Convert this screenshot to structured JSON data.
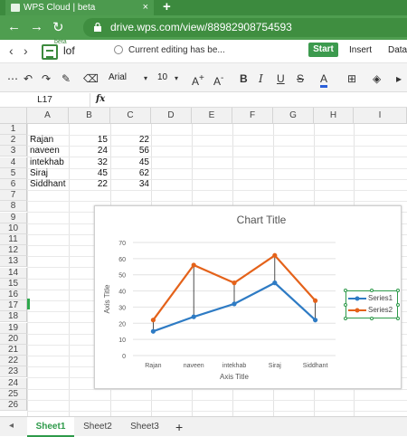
{
  "browser": {
    "tab_title": "WPS Cloud | beta",
    "tab_close": "×",
    "new_tab": "+",
    "url": "drive.wps.com/view/88982908754593"
  },
  "app": {
    "file_name": "lof",
    "beta_label": "beta",
    "status_text": "Current editing has be...",
    "menus": [
      "Start",
      "Insert",
      "Data"
    ]
  },
  "toolbar": {
    "font": "Arial",
    "size": "10",
    "bold": "B",
    "font_color_letter": "A"
  },
  "formula_bar": {
    "cell_ref": "L17",
    "fx": "fx"
  },
  "sheet": {
    "columns": [
      "A",
      "B",
      "C",
      "D",
      "E",
      "F",
      "G",
      "H",
      "I"
    ],
    "rows": [
      "1",
      "2",
      "3",
      "4",
      "5",
      "6",
      "7",
      "8",
      "9",
      "10",
      "11",
      "12",
      "13",
      "14",
      "15",
      "16",
      "17",
      "18",
      "19",
      "20",
      "21",
      "22",
      "23",
      "24",
      "25",
      "26"
    ],
    "data": [
      [
        "Rajan",
        "15",
        "22"
      ],
      [
        "naveen",
        "24",
        "56"
      ],
      [
        "intekhab",
        "32",
        "45"
      ],
      [
        "Siraj",
        "45",
        "62"
      ],
      [
        "Siddhant",
        "22",
        "34"
      ]
    ]
  },
  "chart_data": {
    "type": "line",
    "title": "Chart Title",
    "xlabel": "Axis Title",
    "ylabel": "Axis Title",
    "categories": [
      "Rajan",
      "naveen",
      "intekhab",
      "Siraj",
      "Siddhant"
    ],
    "ylim": [
      0,
      70
    ],
    "yticks": [
      "0",
      "10",
      "20",
      "30",
      "40",
      "50",
      "60",
      "70"
    ],
    "grid": true,
    "legend_position": "right",
    "series": [
      {
        "name": "Series1",
        "values": [
          15,
          24,
          32,
          45,
          22
        ],
        "color": "#2e7bc4"
      },
      {
        "name": "Series2",
        "values": [
          22,
          56,
          45,
          62,
          34
        ],
        "color": "#e4621a"
      }
    ]
  },
  "sheet_tabs": [
    "Sheet1",
    "Sheet2",
    "Sheet3"
  ],
  "add_sheet": "+",
  "colors": {
    "brand": "#3c8a3e",
    "accent": "#2e9a4a"
  }
}
